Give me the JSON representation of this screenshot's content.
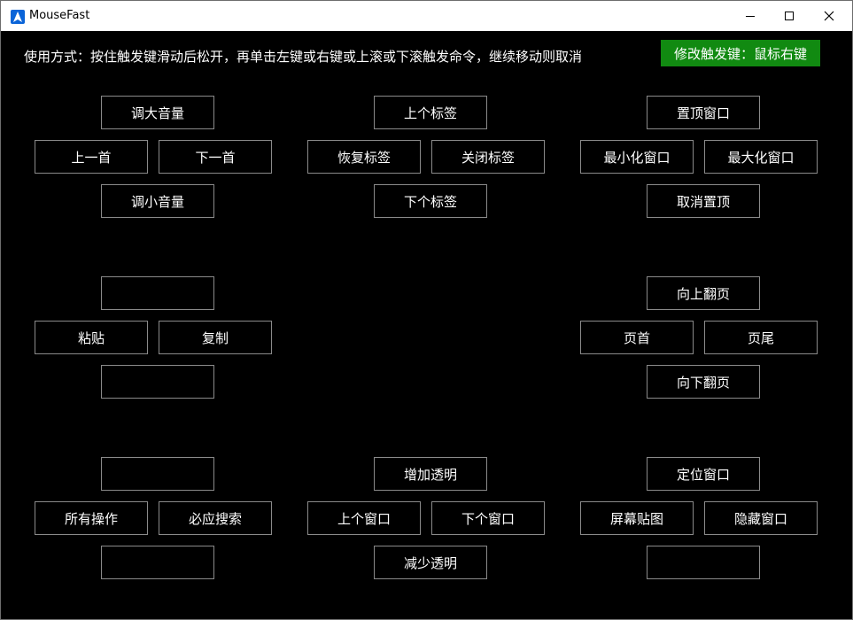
{
  "window": {
    "title": "MouseFast",
    "icon": "app-arrow-icon",
    "controls": {
      "minimize": "minimize-icon",
      "maximize": "maximize-icon",
      "close": "close-icon"
    }
  },
  "header": {
    "instructions": "使用方式：按住触发键滑动后松开，再单击左键或右键或上滚或下滚触发命令，继续移动则取消",
    "trigger_button": "修改触发键：鼠标右键",
    "trigger_color": "#118a11"
  },
  "groups": {
    "volume": {
      "up": "调大音量",
      "left": "上一首",
      "right": "下一首",
      "down": "调小音量"
    },
    "tabs": {
      "up": "上个标签",
      "left": "恢复标签",
      "right": "关闭标签",
      "down": "下个标签"
    },
    "window_state": {
      "up": "置顶窗口",
      "left": "最小化窗口",
      "right": "最大化窗口",
      "down": "取消置顶"
    },
    "clipboard": {
      "up": "",
      "left": "粘贴",
      "right": "复制",
      "down": ""
    },
    "paging": {
      "up": "向上翻页",
      "left": "页首",
      "right": "页尾",
      "down": "向下翻页"
    },
    "misc": {
      "up": "",
      "left": "所有操作",
      "right": "必应搜索",
      "down": ""
    },
    "transparency": {
      "up": "增加透明",
      "left": "上个窗口",
      "right": "下个窗口",
      "down": "减少透明"
    },
    "window_tools": {
      "up": "定位窗口",
      "left": "屏幕贴图",
      "right": "隐藏窗口",
      "down": ""
    }
  }
}
